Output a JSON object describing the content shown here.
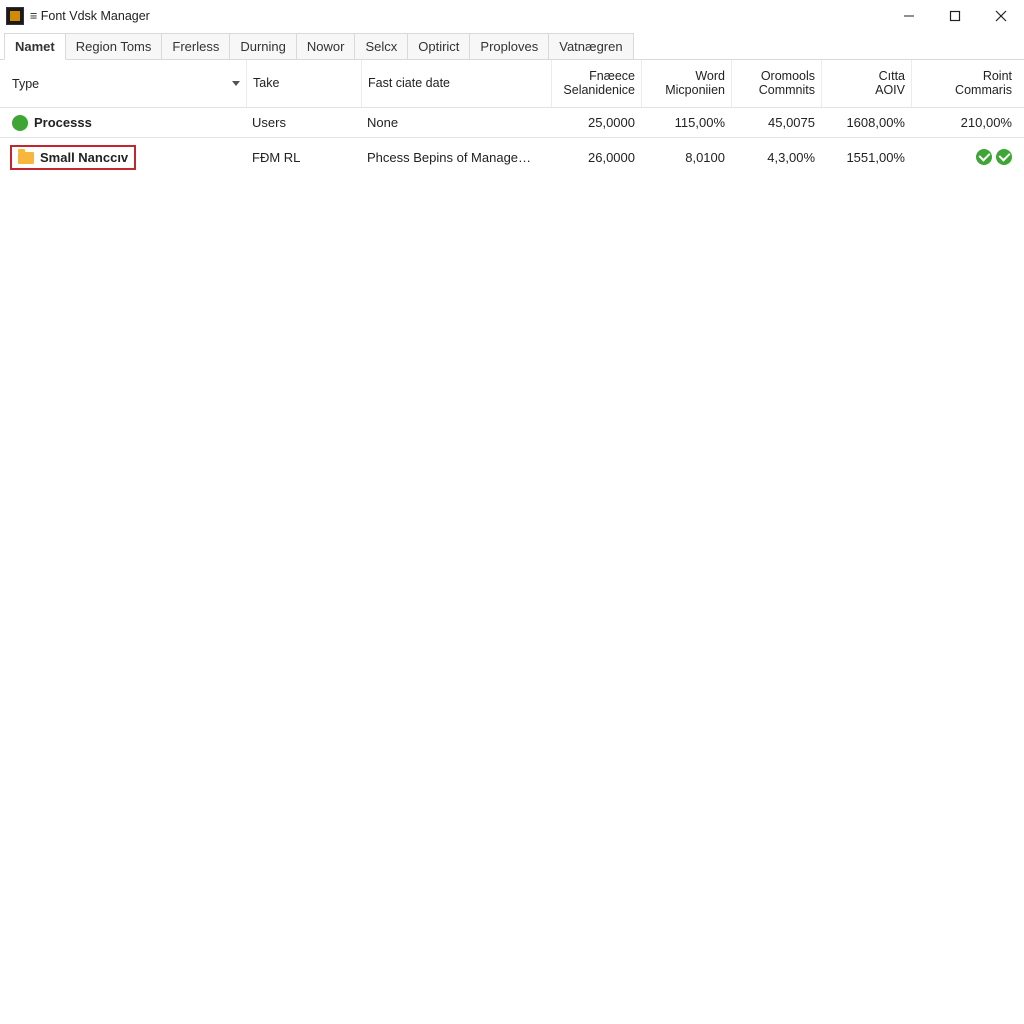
{
  "window": {
    "title": "≡ Font Vdsk Manager"
  },
  "tabs": [
    {
      "label": "Namet",
      "active": true
    },
    {
      "label": "Region Toms",
      "active": false
    },
    {
      "label": "Frerless",
      "active": false
    },
    {
      "label": "Durning",
      "active": false
    },
    {
      "label": "Nowor",
      "active": false
    },
    {
      "label": "Selcx",
      "active": false
    },
    {
      "label": "Optirict",
      "active": false
    },
    {
      "label": "Proploves",
      "active": false
    },
    {
      "label": "Vatnægren",
      "active": false
    }
  ],
  "columns": {
    "c0": "Type",
    "c1": "Take",
    "c2": "Fast ciate date",
    "c3a": "Fnæece",
    "c3b": "Selanidenice",
    "c4a": "Word",
    "c4b": "Micponiien",
    "c5a": "Oromools",
    "c5b": "Commnits",
    "c6a": "Cıtta",
    "c6b": "AOIV",
    "c7a": "Roint",
    "c7b": "Commaris"
  },
  "rows": [
    {
      "icon": "globe",
      "name": "Processs",
      "take": "Users",
      "fast": "None",
      "v3": "25,0000",
      "v4": "115,00%",
      "v5": "45,0075",
      "v6": "1608,00%",
      "v7": "210,00%",
      "checks": false,
      "highlight": false
    },
    {
      "icon": "folder",
      "name": "Small Nanccıv",
      "take": "FÐM RL",
      "fast": "Phcess Bepins of Manage…",
      "v3": "26,0000",
      "v4": "8,0100",
      "v5": "4,3,00%",
      "v6": "1551,00%",
      "v7": "",
      "checks": true,
      "highlight": true
    }
  ]
}
